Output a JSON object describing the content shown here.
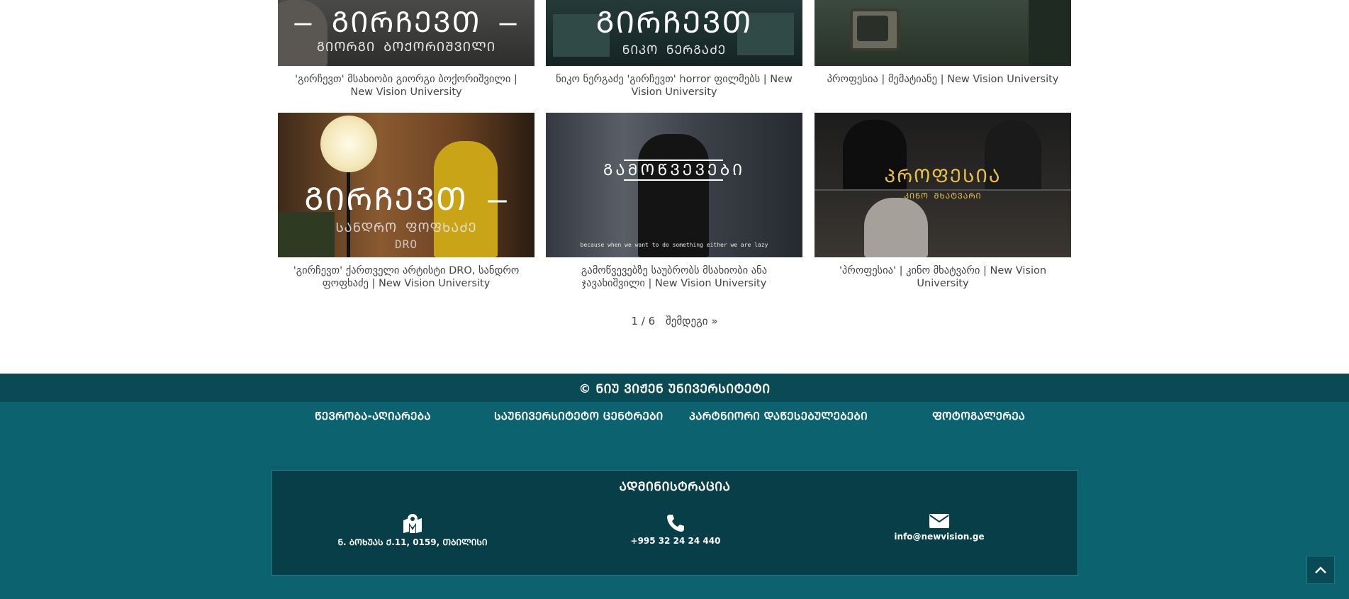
{
  "videos": [
    {
      "thumb_title": "— ᲒᲘᲠᲩᲔᲕᲗ —",
      "thumb_sub": "ᲒᲘᲝᲠᲒᲘ ᲑᲝᲥᲝᲠᲘᲨᲕᲘᲚᲘ",
      "caption": "'გირჩევთ' მსახიობი გიორგი ბოქორიშვილი | New Vision University"
    },
    {
      "thumb_title": "ᲒᲘᲠᲩᲔᲕᲗ",
      "thumb_sub": "ᲜᲘᲙᲝ ᲜᲔᲠᲒᲐᲫᲔ",
      "caption": "ნიკო ნერგაძე 'გირჩევთ' horror ფილმებს | New Vision University"
    },
    {
      "thumb_title": "",
      "thumb_sub": "",
      "caption": "პროფესია | მემატიანე | New Vision University"
    },
    {
      "thumb_title": "ᲒᲘᲠᲩᲔᲕᲗ —",
      "thumb_sub": "ᲡᲐᲜᲓᲠᲝ ᲤᲝᲤᲮᲐᲫᲔ",
      "thumb_sub2": "DRO",
      "caption": "'გირჩევთ' ქართველი არტისტი DRO, სანდრო ფოფხაძე | New Vision University"
    },
    {
      "thumb_title": "ᲒᲐᲛᲝᲬᲕᲔᲕᲔᲑᲘ",
      "thumb_sub": "because when we want to do something either we are lazy",
      "caption": "გამოწვევებზე საუბრობს მსახიობი ანა ჯავახიშვილი | New Vision University"
    },
    {
      "thumb_title": "ᲞᲠᲝᲤᲔᲡᲘᲐ",
      "thumb_sub": "ᲙᲘᲜᲝ ᲛᲮᲐᲢᲕᲐᲠᲘ",
      "caption": "'პროფესია' | კინო მხატვარი | New Vision University"
    }
  ],
  "pagination": {
    "current": "1 / 6",
    "next": "შემდეგი »"
  },
  "footer": {
    "copyright": "© ᲜᲘᲣ ᲕᲘᲟᲔᲜ ᲣᲜᲘᲕᲔᲠᲡᲘᲢᲔᲢᲘ",
    "links": [
      "ᲬᲔᲕᲠᲝᲑᲐ-ᲐᲦᲘᲐᲠᲔᲑᲐ",
      "ᲡᲐᲣᲜᲘᲕᲔᲠᲡᲘᲢᲔᲢᲝ ᲪᲔᲜᲢᲠᲔᲑᲘ",
      "ᲞᲐᲠᲢᲜᲘᲝᲠᲘ ᲓᲐᲬᲔᲡᲔᲑᲣᲚᲔᲑᲔᲑᲘ",
      "ᲤᲝᲢᲝᲒᲐᲚᲔᲠᲔᲐ"
    ],
    "admin_title": "ᲐᲓᲛᲘᲜᲘᲡᲢᲠᲐᲪᲘᲐ",
    "address": "Ნ. ᲑᲝᲮᲣᲐᲡ Ქ.11, 0159, ᲗᲑᲘᲚᲘᲡᲘ",
    "phone": "+995 32 24 24 440",
    "email": "info@newvision.ge",
    "address_icon": "map-marker-icon",
    "phone_icon": "phone-icon",
    "email_icon": "envelope-icon"
  },
  "colors": {
    "footer_dark": "#0a4a55",
    "footer_main": "#0d6270",
    "admin_box": "#073e48"
  }
}
